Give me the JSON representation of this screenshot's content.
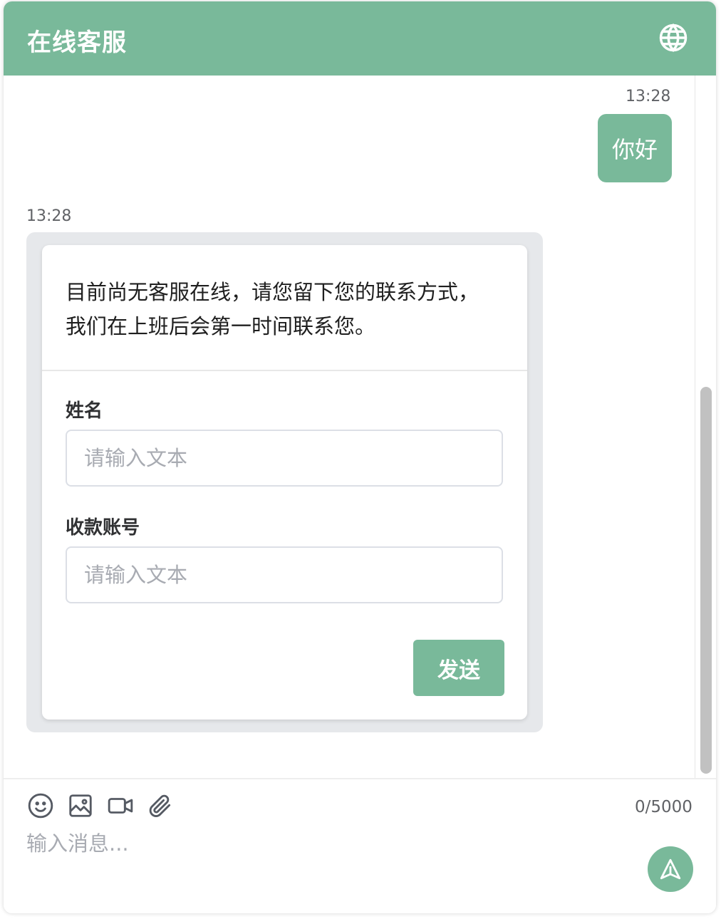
{
  "header": {
    "title": "在线客服",
    "language_icon": "globe-icon"
  },
  "conversation": {
    "user_message": {
      "time": "13:28",
      "text": "你好"
    },
    "agent_message": {
      "time": "13:28",
      "text": "目前尚无客服在线，请您留下您的联系方式，我们在上班后会第一时间联系您。",
      "form": {
        "fields": [
          {
            "label": "姓名",
            "placeholder": "请输入文本",
            "value": ""
          },
          {
            "label": "收款账号",
            "placeholder": "请输入文本",
            "value": ""
          }
        ],
        "submit_label": "发送"
      }
    }
  },
  "composer": {
    "tools": [
      "emoji-icon",
      "image-icon",
      "video-icon",
      "attachment-icon"
    ],
    "counter": "0/5000",
    "placeholder": "输入消息...",
    "send_icon": "send-icon"
  },
  "colors": {
    "accent": "#79b99a",
    "card_bg": "#e6e8eb"
  }
}
